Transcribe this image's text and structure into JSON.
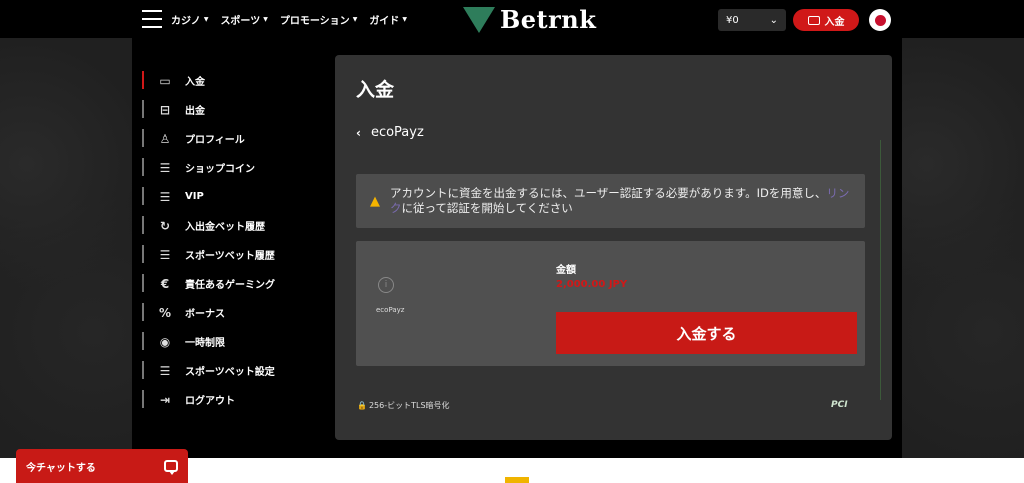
{
  "header": {
    "nav": [
      {
        "label": "カジノ"
      },
      {
        "label": "スポーツ"
      },
      {
        "label": "プロモーション"
      },
      {
        "label": "ガイド"
      }
    ],
    "logo_text": "Betrnk",
    "balance": "¥0",
    "deposit_label": "入金"
  },
  "sidebar": {
    "items": [
      {
        "label": "入金",
        "icon": "cash-icon"
      },
      {
        "label": "出金",
        "icon": "atm-icon"
      },
      {
        "label": "プロフィール",
        "icon": "user-icon"
      },
      {
        "label": "ショップコイン",
        "icon": "sliders-icon"
      },
      {
        "label": "VIP",
        "icon": "sliders-icon"
      },
      {
        "label": "入出金ベット履歴",
        "icon": "history-icon"
      },
      {
        "label": "スポーツベット履歴",
        "icon": "sliders-icon"
      },
      {
        "label": "責任あるゲーミング",
        "icon": "euro-icon"
      },
      {
        "label": "ボーナス",
        "icon": "percent-icon"
      },
      {
        "label": "一時制限",
        "icon": "eye-icon"
      },
      {
        "label": "スポーツベット設定",
        "icon": "sliders-icon"
      },
      {
        "label": "ログアウト",
        "icon": "logout-icon"
      }
    ]
  },
  "panel": {
    "title": "入金",
    "back_label": "ecoPayz",
    "warning_before": "アカウントに資金を出金するには、ユーザー認証する必要があります。IDを用意し、",
    "warning_link": "リンク",
    "warning_after": "に従って認証を開始してください",
    "method_name": "ecoPayz",
    "amount_label": "金額",
    "amount_value": "2,000.00 JPY",
    "submit_label": "入金する",
    "secure_text": "256-ビットTLS暗号化",
    "pci_text": "PCI"
  },
  "chat": {
    "label": "今チャットする"
  },
  "colors": {
    "accent": "#c81a16",
    "warning_icon": "#f5b400",
    "link": "#7a6bb0"
  }
}
